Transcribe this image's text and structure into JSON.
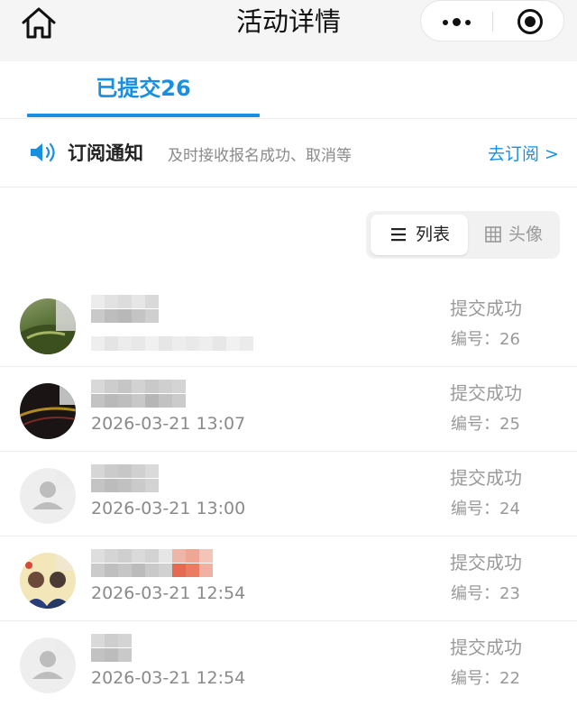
{
  "header": {
    "title": "活动详情",
    "home_icon": "home-icon",
    "more_icon": "more-icon",
    "close_icon": "close-icon"
  },
  "tab": {
    "label": "已提交26"
  },
  "notice": {
    "icon": "speaker-icon",
    "title": "订阅通知",
    "description": "及时接收报名成功、取消等",
    "link": "去订阅 >"
  },
  "view_toggle": {
    "options": [
      {
        "label": "列表",
        "icon": "list-icon",
        "selected": true
      },
      {
        "label": "头像",
        "icon": "grid-icon",
        "selected": false
      }
    ]
  },
  "colors": {
    "accent": "#1a8fe0",
    "muted": "#9a9a9a",
    "divider": "#ececec"
  },
  "submissions": [
    {
      "time": "",
      "status": "提交成功",
      "number": "编号：26"
    },
    {
      "time": "2026-03-21 13:07",
      "status": "提交成功",
      "number": "编号：25"
    },
    {
      "time": "2026-03-21 13:00",
      "status": "提交成功",
      "number": "编号：24"
    },
    {
      "time": "2026-03-21 12:54",
      "status": "提交成功",
      "number": "编号：23"
    },
    {
      "time": "2026-03-21 12:54",
      "status": "提交成功",
      "number": "编号：22"
    }
  ]
}
